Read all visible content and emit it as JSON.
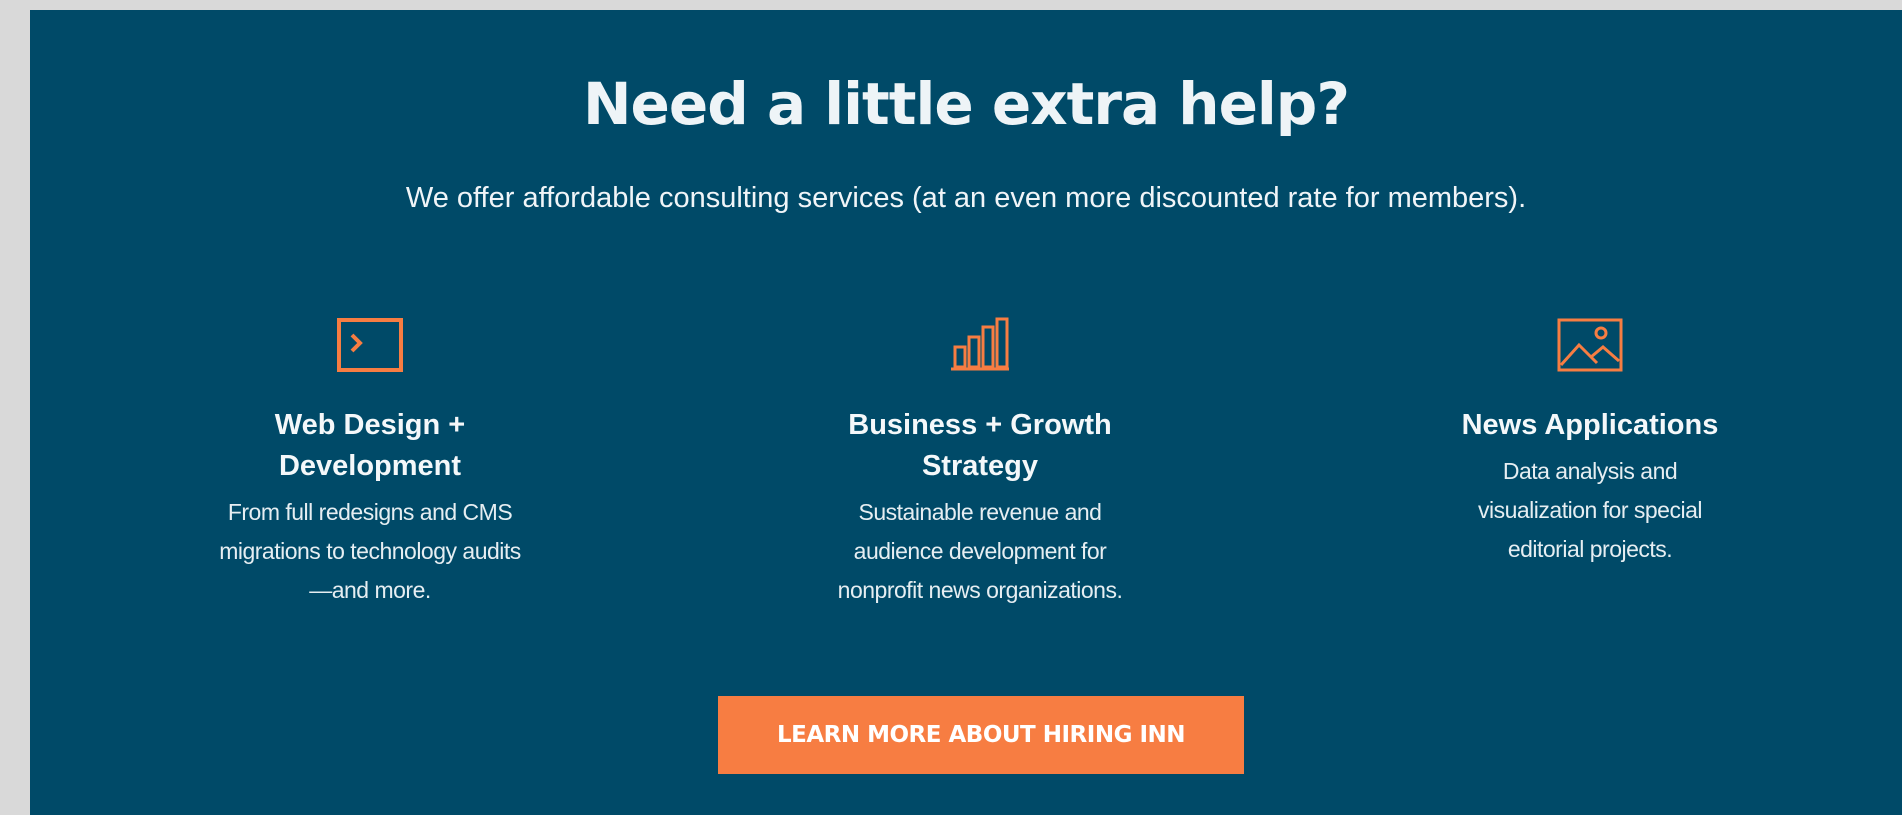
{
  "section": {
    "headline": "Need a little extra help?",
    "subhead": "We offer affordable consulting services (at an even more discounted rate for members)."
  },
  "services": [
    {
      "icon": "terminal-icon",
      "title": "Web Design + Development",
      "description": "From full redesigns and CMS migrations to technology audits—and more."
    },
    {
      "icon": "bar-chart-icon",
      "title": "Business + Growth Strategy",
      "description": "Sustainable revenue and audience development for nonprofit news organizations."
    },
    {
      "icon": "image-icon",
      "title": "News Applications",
      "description": "Data analysis and visualization for special editorial projects."
    }
  ],
  "cta": {
    "label": "LEARN MORE ABOUT HIRING INN"
  },
  "colors": {
    "background": "#004a68",
    "accent": "#f77d42",
    "page_border": "#d9d9d9"
  }
}
